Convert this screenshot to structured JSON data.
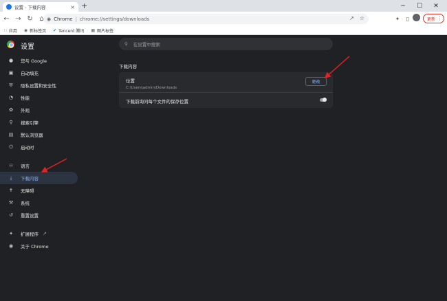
{
  "browser": {
    "tab_title": "设置 - 下载内容",
    "tab_close": "×",
    "new_tab": "+",
    "window_controls": {
      "minimize": "−",
      "maximize": "☐",
      "close": "✕"
    },
    "omnibox": {
      "chip": "Chrome",
      "separator": "|",
      "url": "chrome://settings/downloads"
    },
    "update_button": "更新",
    "bookmarks": [
      {
        "label": "应用",
        "icon": "apps-icon"
      },
      {
        "label": "新标签页",
        "icon": "globe-icon"
      },
      {
        "label": "Tencent 腾讯",
        "icon": "tencent-icon"
      },
      {
        "label": "图片标签",
        "icon": "image-icon"
      }
    ]
  },
  "settings": {
    "title": "设置",
    "search_placeholder": "在设置中搜索",
    "nav": [
      {
        "label": "您与 Google",
        "icon": "person-icon"
      },
      {
        "label": "自动填充",
        "icon": "clipboard-icon"
      },
      {
        "label": "隐私设置和安全性",
        "icon": "shield-icon"
      },
      {
        "label": "性能",
        "icon": "speedometer-icon"
      },
      {
        "label": "外观",
        "icon": "palette-icon"
      },
      {
        "label": "搜索引擎",
        "icon": "search-icon"
      },
      {
        "label": "默认浏览器",
        "icon": "browser-icon"
      },
      {
        "label": "启动时",
        "icon": "power-icon"
      },
      {
        "label": "语言",
        "icon": "language-icon"
      },
      {
        "label": "下载内容",
        "icon": "download-icon",
        "active": true
      },
      {
        "label": "无障碍",
        "icon": "accessibility-icon"
      },
      {
        "label": "系统",
        "icon": "wrench-icon"
      },
      {
        "label": "重置设置",
        "icon": "history-icon"
      },
      {
        "label": "扩展程序",
        "icon": "puzzle-icon"
      },
      {
        "label": "关于 Chrome",
        "icon": "chrome-icon"
      }
    ],
    "downloads": {
      "section_title": "下载内容",
      "location_label": "位置",
      "location_path": "C:\\Users\\admin\\Downloads",
      "change_button": "更改",
      "ask_label": "下载前询问每个文件的保存位置",
      "ask_enabled": false
    }
  },
  "colors": {
    "annotation_arrow": "#e32222",
    "accent": "#8ab4f8",
    "update_red": "#d93025"
  }
}
